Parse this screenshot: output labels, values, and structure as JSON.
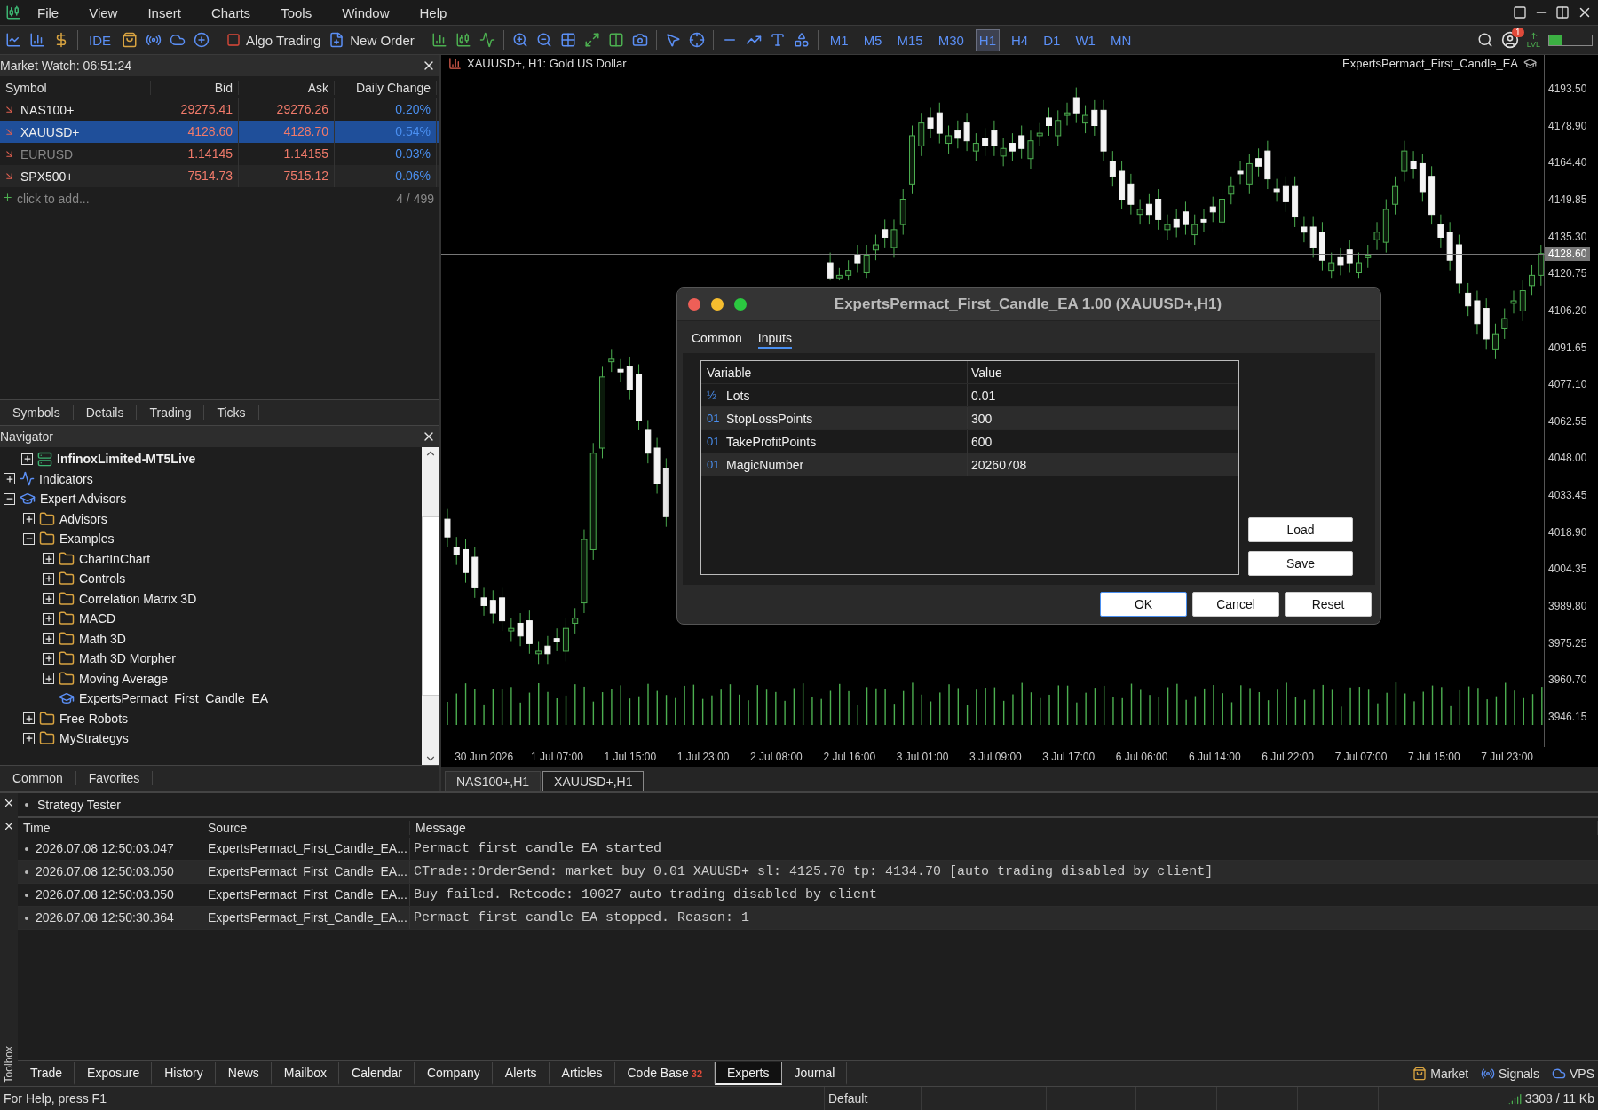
{
  "menu": [
    "File",
    "View",
    "Insert",
    "Charts",
    "Tools",
    "Window",
    "Help"
  ],
  "toolbar": {
    "ide": "IDE",
    "algo_trading": "Algo Trading",
    "new_order": "New Order",
    "timeframes": [
      {
        "label": "M1",
        "selected": false
      },
      {
        "label": "M5",
        "selected": false
      },
      {
        "label": "M15",
        "selected": false
      },
      {
        "label": "M30",
        "selected": false
      },
      {
        "label": "H1",
        "selected": true
      },
      {
        "label": "H4",
        "selected": false
      },
      {
        "label": "D1",
        "selected": false
      },
      {
        "label": "W1",
        "selected": false
      },
      {
        "label": "MN",
        "selected": false
      }
    ],
    "notifications": "1",
    "level": "LVL"
  },
  "market_watch": {
    "title": "Market Watch: 06:51:24",
    "columns": [
      "Symbol",
      "Bid",
      "Ask",
      "Daily Change"
    ],
    "rows": [
      {
        "symbol": "NAS100+",
        "bid": "29275.41",
        "ask": "29276.26",
        "change": "0.20%",
        "selected": false,
        "dimmed": false
      },
      {
        "symbol": "XAUUSD+",
        "bid": "4128.60",
        "ask": "4128.70",
        "change": "0.54%",
        "selected": true,
        "dimmed": false
      },
      {
        "symbol": "EURUSD",
        "bid": "1.14145",
        "ask": "1.14155",
        "change": "0.03%",
        "selected": false,
        "dimmed": true
      },
      {
        "symbol": "SPX500+",
        "bid": "7514.73",
        "ask": "7515.12",
        "change": "0.06%",
        "selected": false,
        "dimmed": false
      }
    ],
    "add": "click to add...",
    "count": "4 / 499",
    "tabs": [
      "Symbols",
      "Details",
      "Trading",
      "Ticks"
    ]
  },
  "navigator": {
    "title": "Navigator",
    "tree": [
      {
        "label": "InfinoxLimited-MT5Live",
        "kind": "server",
        "expanded": false
      },
      {
        "label": "Indicators",
        "kind": "indicators",
        "expanded": false
      },
      {
        "label": "Expert Advisors",
        "kind": "experts",
        "expanded": true,
        "children": [
          {
            "label": "Advisors",
            "kind": "folder",
            "expanded": false
          },
          {
            "label": "Examples",
            "kind": "folder",
            "expanded": true,
            "children": [
              {
                "label": "ChartInChart",
                "kind": "folder",
                "expanded": false
              },
              {
                "label": "Controls",
                "kind": "folder",
                "expanded": false
              },
              {
                "label": "Correlation Matrix 3D",
                "kind": "folder",
                "expanded": false
              },
              {
                "label": "MACD",
                "kind": "folder",
                "expanded": false
              },
              {
                "label": "Math 3D",
                "kind": "folder",
                "expanded": false
              },
              {
                "label": "Math 3D Morpher",
                "kind": "folder",
                "expanded": false
              },
              {
                "label": "Moving Average",
                "kind": "folder",
                "expanded": false
              },
              {
                "label": "ExpertsPermact_First_Candle_EA",
                "kind": "expert"
              }
            ]
          },
          {
            "label": "Free Robots",
            "kind": "folder",
            "expanded": false
          },
          {
            "label": "MyStrategys",
            "kind": "folder",
            "expanded": false
          }
        ]
      }
    ],
    "tabs": [
      "Common",
      "Favorites"
    ]
  },
  "chart": {
    "symbol": "XAUUSD+, H1:  Gold US Dollar",
    "expert": "ExpertsPermact_First_Candle_EA",
    "current_price": "4128.60",
    "chart_data": {
      "type": "candlestick",
      "ylim": [
        3934.25,
        4206.78
      ],
      "categories": [
        null,
        null,
        null,
        null,
        "30 Jun 2026",
        null,
        null,
        null,
        null,
        null,
        null,
        null,
        "1 Jul 07:00",
        null,
        null,
        null,
        null,
        null,
        null,
        null,
        "1 Jul 15:00",
        null,
        null,
        null,
        null,
        null,
        null,
        null,
        "1 Jul 23:00",
        null,
        null,
        null,
        null,
        null,
        null,
        null,
        "2 Jul 08:00",
        null,
        null,
        null,
        null,
        null,
        null,
        null,
        "2 Jul 16:00",
        null,
        null,
        null,
        null,
        null,
        null,
        null,
        "3 Jul 01:00",
        null,
        null,
        null,
        null,
        null,
        null,
        null,
        "3 Jul 09:00",
        null,
        null,
        null,
        null,
        null,
        null,
        null,
        "3 Jul 17:00",
        null,
        null,
        null,
        null,
        null,
        null,
        null,
        "6 Jul 06:00",
        null,
        null,
        null,
        null,
        null,
        null,
        null,
        "6 Jul 14:00",
        null,
        null,
        null,
        null,
        null,
        null,
        null,
        "6 Jul 22:00",
        null,
        null,
        null,
        null,
        null,
        null,
        null,
        "7 Jul 07:00",
        null,
        null,
        null,
        null,
        null,
        null,
        null,
        "7 Jul 15:00",
        null,
        null,
        null,
        null,
        null,
        null,
        null,
        "7 Jul 23:00",
        null,
        null,
        null,
        null
      ],
      "yticks": [
        {
          "value": 4193.5,
          "label": "4193.50"
        },
        {
          "value": 4178.9,
          "label": "4178.90"
        },
        {
          "value": 4164.4,
          "label": "4164.40"
        },
        {
          "value": 4149.85,
          "label": "4149.85"
        },
        {
          "value": 4135.3,
          "label": "4135.30"
        },
        {
          "value": 4120.75,
          "label": "4120.75"
        },
        {
          "value": 4106.2,
          "label": "4106.20"
        },
        {
          "value": 4091.65,
          "label": "4091.65"
        },
        {
          "value": 4077.1,
          "label": "4077.10"
        },
        {
          "value": 4062.55,
          "label": "4062.55"
        },
        {
          "value": 4048.0,
          "label": "4048.00"
        },
        {
          "value": 4033.45,
          "label": "4033.45"
        },
        {
          "value": 4018.9,
          "label": "4018.90"
        },
        {
          "value": 4004.35,
          "label": "4004.35"
        },
        {
          "value": 3989.8,
          "label": "3989.80"
        },
        {
          "value": 3975.25,
          "label": "3975.25"
        },
        {
          "value": 3960.7,
          "label": "3960.70"
        },
        {
          "value": 3946.15,
          "label": "3946.15"
        }
      ],
      "ohlc": [
        [
          4024,
          4028,
          4013,
          4017
        ],
        [
          4013,
          4017,
          4006,
          4010
        ],
        [
          4012,
          4016,
          3999,
          4003
        ],
        [
          4009,
          4013,
          3993,
          3997
        ],
        [
          3993,
          3997,
          3986,
          3990
        ],
        [
          3992,
          3996,
          3983,
          3987
        ],
        [
          3993,
          3997,
          3980,
          3984
        ],
        [
          3980,
          3985,
          3976,
          3981
        ],
        [
          3983,
          3987,
          3974,
          3978
        ],
        [
          3984,
          3988,
          3971,
          3975
        ],
        [
          3971,
          3976,
          3967,
          3972
        ],
        [
          3974,
          3978,
          3967,
          3971
        ],
        [
          3977,
          3981,
          3972,
          3976
        ],
        [
          3972,
          3985,
          3968,
          3981
        ],
        [
          3983,
          3989,
          3979,
          3985
        ],
        [
          3991,
          4020,
          3987,
          4016
        ],
        [
          4012,
          4054,
          4008,
          4050
        ],
        [
          4052,
          4084,
          4048,
          4080
        ],
        [
          4086,
          4091,
          4082,
          4087
        ],
        [
          4083,
          4087,
          4078,
          4082
        ],
        [
          4084,
          4088,
          4071,
          4075
        ],
        [
          4081,
          4085,
          4059,
          4063
        ],
        [
          4059,
          4063,
          4046,
          4050
        ],
        [
          4052,
          4056,
          4034,
          4038
        ],
        [
          4044,
          4048,
          4021,
          4025
        ],
        null,
        null,
        null,
        null,
        null,
        null,
        null,
        null,
        null,
        null,
        null,
        null,
        null,
        null,
        null,
        null,
        null,
        [
          4125,
          4129,
          4118,
          4119
        ],
        [
          4119,
          4123,
          4118,
          4120
        ],
        [
          4120,
          4126,
          4118,
          4122
        ],
        [
          4128,
          4132,
          4121,
          4125
        ],
        [
          4121,
          4132,
          4119,
          4128
        ],
        [
          4130,
          4136,
          4126,
          4132
        ],
        [
          4138,
          4142,
          4131,
          4135
        ],
        [
          4131,
          4142,
          4127,
          4138
        ],
        [
          4140,
          4154,
          4136,
          4150
        ],
        [
          4156,
          4179,
          4152,
          4175
        ],
        [
          4171,
          4184,
          4167,
          4180
        ],
        [
          4182,
          4186,
          4174,
          4178
        ],
        [
          4184,
          4188,
          4172,
          4176
        ],
        [
          4172,
          4179,
          4168,
          4175
        ],
        [
          4177,
          4181,
          4170,
          4174
        ],
        [
          4180,
          4184,
          4169,
          4173
        ],
        [
          4169,
          4176,
          4165,
          4172
        ],
        [
          4174,
          4178,
          4167,
          4171
        ],
        [
          4177,
          4181,
          4167,
          4171
        ],
        [
          4167,
          4174,
          4163,
          4170
        ],
        [
          4172,
          4176,
          4165,
          4169
        ],
        [
          4175,
          4179,
          4166,
          4170
        ],
        [
          4166,
          4177,
          4162,
          4173
        ],
        [
          4175,
          4180,
          4171,
          4176
        ],
        [
          4182,
          4186,
          4175,
          4179
        ],
        [
          4175,
          4185,
          4171,
          4181
        ],
        [
          4183,
          4188,
          4179,
          4184
        ],
        [
          4190,
          4194,
          4180,
          4184
        ],
        [
          4180,
          4187,
          4176,
          4183
        ],
        [
          4185,
          4189,
          4175,
          4179
        ],
        [
          4185,
          4189,
          4165,
          4169
        ],
        [
          4165,
          4169,
          4155,
          4159
        ],
        [
          4161,
          4165,
          4146,
          4150
        ],
        [
          4156,
          4160,
          4144,
          4148
        ],
        [
          4144,
          4150,
          4140,
          4146
        ],
        [
          4148,
          4152,
          4140,
          4144
        ],
        [
          4150,
          4154,
          4138,
          4142
        ],
        [
          4138,
          4144,
          4134,
          4140
        ],
        [
          4142,
          4146,
          4135,
          4139
        ],
        [
          4145,
          4149,
          4136,
          4140
        ],
        [
          4136,
          4144,
          4132,
          4140
        ],
        [
          4142,
          4146,
          4137,
          4141
        ],
        [
          4147,
          4151,
          4141,
          4145
        ],
        [
          4141,
          4154,
          4137,
          4150
        ],
        [
          4152,
          4159,
          4148,
          4155
        ],
        [
          4161,
          4165,
          4156,
          4160
        ],
        [
          4156,
          4168,
          4152,
          4164
        ],
        [
          4166,
          4170,
          4159,
          4163
        ],
        [
          4169,
          4173,
          4154,
          4158
        ],
        [
          4154,
          4158,
          4149,
          4153
        ],
        [
          4155,
          4159,
          4145,
          4149
        ],
        [
          4155,
          4159,
          4139,
          4143
        ],
        [
          4139,
          4143,
          4133,
          4137
        ],
        [
          4139,
          4143,
          4127,
          4131
        ],
        [
          4137,
          4141,
          4122,
          4126
        ],
        [
          4122,
          4129,
          4119,
          4125
        ],
        [
          4127,
          4131,
          4120,
          4124
        ],
        [
          4130,
          4134,
          4121,
          4125
        ],
        [
          4121,
          4129,
          4119,
          4125
        ],
        [
          4127,
          4132,
          4123,
          4128
        ],
        [
          4134,
          4141,
          4130,
          4137
        ],
        [
          4133,
          4150,
          4129,
          4146
        ],
        [
          4148,
          4159,
          4144,
          4155
        ],
        [
          4161,
          4173,
          4157,
          4169
        ],
        [
          4165,
          4169,
          4158,
          4162
        ],
        [
          4164,
          4168,
          4149,
          4153
        ],
        [
          4159,
          4163,
          4140,
          4144
        ],
        [
          4140,
          4144,
          4131,
          4135
        ],
        [
          4137,
          4141,
          4122,
          4126
        ],
        [
          4132,
          4136,
          4113,
          4117
        ],
        [
          4113,
          4117,
          4104,
          4108
        ],
        [
          4110,
          4114,
          4097,
          4101
        ],
        [
          4107,
          4111,
          4091,
          4095
        ],
        [
          4091,
          4101,
          4087,
          4097
        ],
        [
          4099,
          4107,
          4095,
          4103
        ],
        [
          4109,
          4114,
          4105,
          4110
        ],
        [
          4106,
          4118,
          4102,
          4114
        ],
        [
          4116,
          4124,
          4112,
          4120
        ],
        [
          4120,
          4132,
          4116,
          4128.6
        ]
      ]
    },
    "tabs": [
      {
        "label": "NAS100+,H1",
        "selected": false
      },
      {
        "label": "XAUUSD+,H1",
        "selected": true
      }
    ]
  },
  "dialog": {
    "title": "ExpertsPermact_First_Candle_EA 1.00 (XAUUSD+,H1)",
    "tabs": [
      {
        "label": "Common",
        "selected": false
      },
      {
        "label": "Inputs",
        "selected": true
      }
    ],
    "columns": [
      "Variable",
      "Value"
    ],
    "rows": [
      {
        "type_mark": "½",
        "name": "Lots",
        "value": "0.01"
      },
      {
        "type_mark": "01",
        "name": "StopLossPoints",
        "value": "300"
      },
      {
        "type_mark": "01",
        "name": "TakeProfitPoints",
        "value": "600"
      },
      {
        "type_mark": "01",
        "name": "MagicNumber",
        "value": "20260708"
      }
    ],
    "side_buttons": [
      "Load",
      "Save"
    ],
    "buttons": [
      {
        "label": "OK",
        "default": true
      },
      {
        "label": "Cancel",
        "default": false
      },
      {
        "label": "Reset",
        "default": false
      }
    ]
  },
  "toolbox": {
    "title": "Strategy Tester",
    "side_label": "Toolbox",
    "columns": [
      "Time",
      "Source",
      "Message"
    ],
    "rows": [
      {
        "time": "2026.07.08 12:50:03.047",
        "source": "ExpertsPermact_First_Candle_EA...",
        "message": "Permact first candle EA started"
      },
      {
        "time": "2026.07.08 12:50:03.050",
        "source": "ExpertsPermact_First_Candle_EA...",
        "message": "CTrade::OrderSend: market buy 0.01 XAUUSD+ sl: 4125.70 tp: 4134.70 [auto trading disabled by client]"
      },
      {
        "time": "2026.07.08 12:50:03.050",
        "source": "ExpertsPermact_First_Candle_EA...",
        "message": "Buy failed. Retcode: 10027 auto trading disabled by client"
      },
      {
        "time": "2026.07.08 12:50:30.364",
        "source": "ExpertsPermact_First_Candle_EA...",
        "message": "Permact first candle EA stopped. Reason: 1"
      }
    ],
    "tabs": [
      {
        "label": "Trade",
        "selected": false
      },
      {
        "label": "Exposure",
        "selected": false
      },
      {
        "label": "History",
        "selected": false
      },
      {
        "label": "News",
        "selected": false
      },
      {
        "label": "Mailbox",
        "selected": false
      },
      {
        "label": "Calendar",
        "selected": false
      },
      {
        "label": "Company",
        "selected": false
      },
      {
        "label": "Alerts",
        "selected": false
      },
      {
        "label": "Articles",
        "selected": false
      },
      {
        "label": "Code Base",
        "badge": "32",
        "selected": false
      },
      {
        "label": "Experts",
        "selected": true
      },
      {
        "label": "Journal",
        "selected": false
      }
    ],
    "links": [
      {
        "kind": "market",
        "label": "Market"
      },
      {
        "kind": "signals",
        "label": "Signals"
      },
      {
        "kind": "vps",
        "label": "VPS"
      }
    ]
  },
  "status_bar": {
    "help": "For Help, press F1",
    "profile": "Default",
    "traffic": "3308 / 11 Kb"
  }
}
